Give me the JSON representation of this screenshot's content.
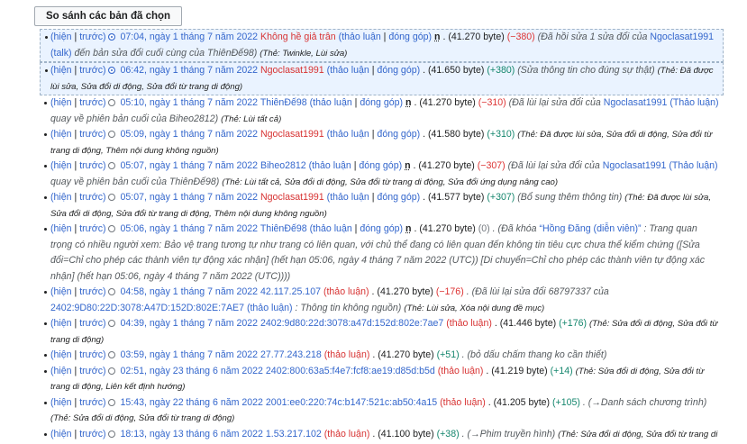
{
  "compare_button": "So sánh các bản đã chọn",
  "rows": [
    {
      "cur": "(hiện",
      "prev": "trước)",
      "radio": "on",
      "ts": "07:04, ngày 1 tháng 7 năm 2022",
      "user": "Không hề giả trân",
      "talk": "(thảo luận",
      "contrib": "đóng góp)",
      "minor": "n",
      "size": ". (41.270 byte)",
      "diff": "(−380)",
      "diff_class": "neg",
      "cmt_pre": "(Đã hồi sửa 1 sửa đổi của",
      "cmt_link": "Ngoclasat1991",
      "cmt_link2": "(talk)",
      "cmt_post": "đến bản sửa đổi cuối cùng của ThiênĐế98)",
      "tags": "(Thẻ: Twinkle, Lùi sửa)"
    },
    {
      "cur": "(hiện",
      "prev": "trước)",
      "radio": "on",
      "ts": "06:42, ngày 1 tháng 7 năm 2022",
      "user": "Ngoclasat1991",
      "talk": "(thảo luận",
      "contrib": "đóng góp)",
      "minor": "",
      "size": ". (41.650 byte)",
      "diff": "(+380)",
      "diff_class": "pos",
      "cmt_pre": "(Sửa thông tin cho đúng sự thật)",
      "cmt_link": "",
      "cmt_link2": "",
      "cmt_post": "",
      "tags": "(Thẻ: Đã được lùi sửa, Sửa đổi di động, Sửa đổi từ trang di động)"
    },
    {
      "cur": "(hiện",
      "prev": "trước)",
      "radio": "off",
      "ts": "05:10, ngày 1 tháng 7 năm 2022",
      "user": "ThiênĐế98",
      "talk": "(thảo luận",
      "contrib": "đóng góp)",
      "minor": "n",
      "size": ". (41.270 byte)",
      "diff": "(−310)",
      "diff_class": "neg",
      "cmt_pre": "(Đã lùi lại sửa đổi của",
      "cmt_link": "Ngoclasat1991",
      "cmt_link2": "(Thảo luận)",
      "cmt_post": "quay về phiên bản cuối của Biheo2812)",
      "tags": "(Thẻ: Lùi tất cả)"
    },
    {
      "cur": "(hiện",
      "prev": "trước)",
      "radio": "off",
      "ts": "05:09, ngày 1 tháng 7 năm 2022",
      "user": "Ngoclasat1991",
      "talk": "(thảo luận",
      "contrib": "đóng góp)",
      "minor": "",
      "size": ". (41.580 byte)",
      "diff": "(+310)",
      "diff_class": "pos",
      "cmt_pre": "",
      "cmt_link": "",
      "cmt_link2": "",
      "cmt_post": "",
      "tags": "(Thẻ: Đã được lùi sửa, Sửa đổi di động, Sửa đổi từ trang di động, Thêm nội dung không nguồn)"
    },
    {
      "cur": "(hiện",
      "prev": "trước)",
      "radio": "off",
      "ts": "05:07, ngày 1 tháng 7 năm 2022",
      "user": "Biheo2812",
      "talk": "(thảo luận",
      "contrib": "đóng góp)",
      "minor": "n",
      "size": ". (41.270 byte)",
      "diff": "(−307)",
      "diff_class": "neg",
      "cmt_pre": "(Đã lùi lại sửa đổi của",
      "cmt_link": "Ngoclasat1991",
      "cmt_link2": "(Thảo luận)",
      "cmt_post": "quay về phiên bản cuối của ThiênĐế98)",
      "tags": "(Thẻ: Lùi tất cả, Sửa đổi di động, Sửa đổi từ trang di động, Sửa đổi ứng dụng nâng cao)"
    },
    {
      "cur": "(hiện",
      "prev": "trước)",
      "radio": "off",
      "ts": "05:07, ngày 1 tháng 7 năm 2022",
      "user": "Ngoclasat1991",
      "talk": "(thảo luận",
      "contrib": "đóng góp)",
      "minor": "",
      "size": ". (41.577 byte)",
      "diff": "(+307)",
      "diff_class": "pos",
      "cmt_pre": "(Bổ sung thêm thông tin)",
      "cmt_link": "",
      "cmt_link2": "",
      "cmt_post": "",
      "tags": "(Thẻ: Đã được lùi sửa, Sửa đổi di động, Sửa đổi từ trang di động, Thêm nội dung không nguồn)"
    },
    {
      "cur": "(hiện",
      "prev": "trước)",
      "radio": "off",
      "ts": "05:06, ngày 1 tháng 7 năm 2022",
      "user": "ThiênĐế98",
      "talk": "(thảo luận",
      "contrib": "đóng góp)",
      "minor": "n",
      "size": ". (41.270 byte)",
      "diff": "(0)",
      "diff_class": "zero",
      "cmt_pre": ". (Đã khóa",
      "cmt_link": "“Hồng Đăng (diễn viên)”",
      "cmt_link2": "",
      "cmt_post": ": Trang quan trọng có nhiều người xem: Bảo vệ trang tương tự như trang có liên quan, với chủ thể đang có liên quan đến không tin tiêu cực chưa thể kiểm chứng ([Sửa đổi=Chỉ cho phép các thành viên tự động xác nhận] (hết hạn 05:06, ngày 4 tháng 7 năm 2022 (UTC)) [Di chuyển=Chỉ cho phép các thành viên tự động xác nhận] (hết hạn 05:06, ngày 4 tháng 7 năm 2022 (UTC))))",
      "tags": ""
    },
    {
      "cur": "(hiện",
      "prev": "trước)",
      "radio": "off",
      "ts": "04:58, ngày 1 tháng 7 năm 2022",
      "user": "42.117.25.107",
      "talk": "(thảo luận)",
      "contrib": "",
      "minor": "",
      "size": ". (41.270 byte)",
      "diff": "(−176)",
      "diff_class": "neg",
      "cmt_pre": ". (Đã lùi lại sửa đổi 68797337 của",
      "cmt_link": "2402:9D80:22D:3078:A47D:152D:802E:7AE7",
      "cmt_link2": "(thảo luận)",
      "cmt_post": ": Thông tin không nguồn)",
      "tags": "(Thẻ: Lùi sửa, Xóa nội dung đề mục)"
    },
    {
      "cur": "(hiện",
      "prev": "trước)",
      "radio": "off",
      "ts": "04:39, ngày 1 tháng 7 năm 2022",
      "user": "2402:9d80:22d:3078:a47d:152d:802e:7ae7",
      "talk": "(thảo luận)",
      "contrib": "",
      "minor": "",
      "size": ". (41.446 byte)",
      "diff": "(+176)",
      "diff_class": "pos",
      "cmt_pre": "",
      "cmt_link": "",
      "cmt_link2": "",
      "cmt_post": "",
      "tags": "(Thẻ: Sửa đổi di động, Sửa đổi từ trang di động)"
    },
    {
      "cur": "(hiện",
      "prev": "trước)",
      "radio": "off",
      "ts": "03:59, ngày 1 tháng 7 năm 2022",
      "user": "27.77.243.218",
      "talk": "(thảo luận)",
      "contrib": "",
      "minor": "",
      "size": ". (41.270 byte)",
      "diff": "(+51)",
      "diff_class": "pos",
      "cmt_pre": ". (bỏ dấu chấm thang ko cần thiết)",
      "cmt_link": "",
      "cmt_link2": "",
      "cmt_post": "",
      "tags": ""
    },
    {
      "cur": "(hiện",
      "prev": "trước)",
      "radio": "off",
      "ts": "02:51, ngày 23 tháng 6 năm 2022",
      "user": "2402:800:63a5:f4e7:fcf8:ae19:d85d:b5d",
      "talk": "(thảo luận)",
      "contrib": "",
      "minor": "",
      "size": ". (41.219 byte)",
      "diff": "(+14)",
      "diff_class": "pos",
      "cmt_pre": "",
      "cmt_link": "",
      "cmt_link2": "",
      "cmt_post": "",
      "tags": "(Thẻ: Sửa đổi di động, Sửa đổi từ trang di động, Liên kết định hướng)"
    },
    {
      "cur": "(hiện",
      "prev": "trước)",
      "radio": "off",
      "ts": "15:43, ngày 22 tháng 6 năm 2022",
      "user": "2001:ee0:220:74c:b147:521c:ab50:4a15",
      "talk": "(thảo luận)",
      "contrib": "",
      "minor": "",
      "size": ". (41.205 byte)",
      "diff": "(+105)",
      "diff_class": "pos",
      "cmt_pre": ". (→Danh sách chương trình)",
      "cmt_link": "",
      "cmt_link2": "",
      "cmt_post": "",
      "tags": "(Thẻ: Sửa đổi di động, Sửa đổi từ trang di động)"
    },
    {
      "cur": "(hiện",
      "prev": "trước)",
      "radio": "off",
      "ts": "18:13, ngày 13 tháng 6 năm 2022",
      "user": "1.53.217.102",
      "talk": "(thảo luận)",
      "contrib": "",
      "minor": "",
      "size": ". (41.100 byte)",
      "diff": "(+38)",
      "diff_class": "pos",
      "cmt_pre": ". (→Phim truyền hình)",
      "cmt_link": "",
      "cmt_link2": "",
      "cmt_post": "",
      "tags": "(Thẻ: Sửa đổi di động, Sửa đổi từ trang di động)"
    }
  ]
}
